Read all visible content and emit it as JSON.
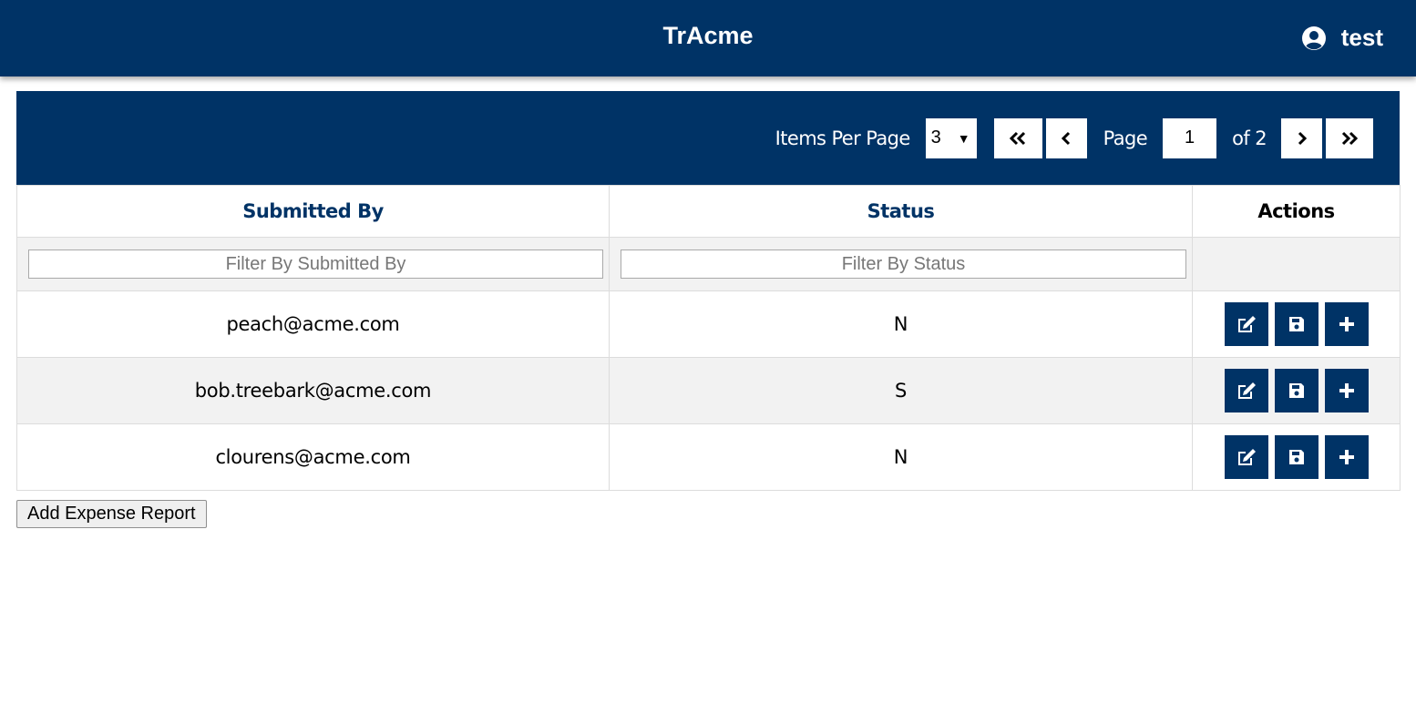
{
  "app": {
    "title": "TrAcme",
    "user_name": "test",
    "header_color": "#003366"
  },
  "pager": {
    "items_per_page_label": "Items Per Page",
    "items_per_page_value": "3",
    "page_label": "Page",
    "current_page": "1",
    "of_label": "of 2",
    "icons": [
      "double-chevron-left-icon",
      "chevron-left-icon",
      "chevron-right-icon",
      "double-chevron-right-icon"
    ]
  },
  "table": {
    "columns": {
      "submitted_by": "Submitted By",
      "status": "Status",
      "actions": "Actions"
    },
    "filters": {
      "submitted_by_placeholder": "Filter By Submitted By",
      "status_placeholder": "Filter By Status"
    },
    "rows": [
      {
        "submitted_by": "peach@acme.com",
        "status": "N"
      },
      {
        "submitted_by": "bob.treebark@acme.com",
        "status": "S"
      },
      {
        "submitted_by": "clourens@acme.com",
        "status": "N"
      }
    ],
    "row_action_icons": [
      "edit-icon",
      "save-icon",
      "plus-icon"
    ]
  },
  "footer": {
    "add_button_label": "Add Expense Report"
  }
}
